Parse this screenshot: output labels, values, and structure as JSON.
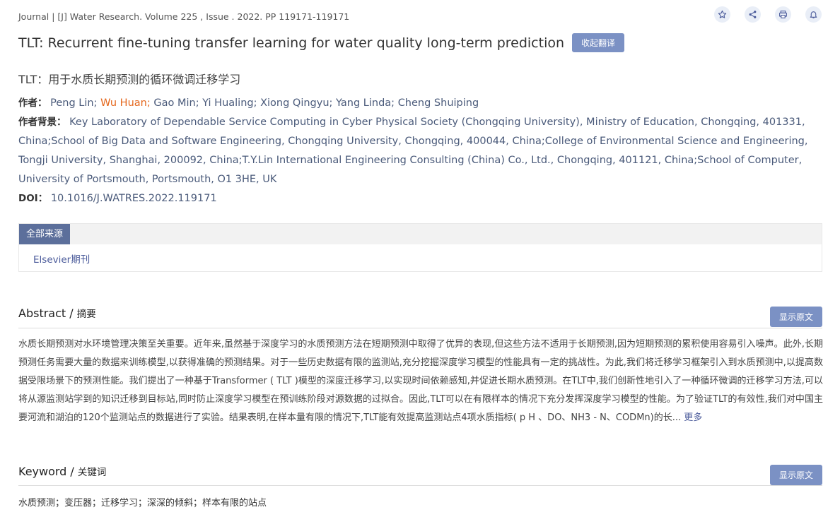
{
  "journal_line": "Journal | [J] Water Research. Volume 225 , Issue . 2022. PP 119171-119171",
  "toolbar": {
    "icons": [
      "star-icon",
      "share-icon",
      "print-icon",
      "bell-icon"
    ]
  },
  "title_en": "TLT: Recurrent fine-tuning transfer learning for water quality long-term prediction",
  "collect_translation_label": "收起翻译",
  "title_cn": "TLT：用于水质长期预测的循环微调迁移学习",
  "authors_label": "作者：",
  "authors": [
    {
      "name": "Peng Lin;",
      "highlight": false
    },
    {
      "name": "Wu Huan;",
      "highlight": true
    },
    {
      "name": "Gao Min;",
      "highlight": false
    },
    {
      "name": "Yi Hualing;",
      "highlight": false
    },
    {
      "name": "Xiong Qingyu;",
      "highlight": false
    },
    {
      "name": "Yang Linda;",
      "highlight": false
    },
    {
      "name": "Cheng Shuiping",
      "highlight": false
    }
  ],
  "affiliation_label": "作者背景：",
  "affiliation": "Key Laboratory of Dependable Service Computing in Cyber Physical Society (Chongqing University), Ministry of Education, Chongqing, 401331, China;School of Big Data and Software Engineering, Chongqing University, Chongqing, 400044, China;College of Environmental Science and Engineering, Tongji University, Shanghai, 200092, China;T.Y.Lin International Engineering Consulting (China) Co., Ltd., Chongqing, 401121, China;School of Computer, University of Portsmouth, Portsmouth, O1 3HE, UK",
  "doi_label": "DOI：",
  "doi": "10.1016/J.WATRES.2022.119171",
  "sources": {
    "tab_label": "全部来源",
    "items": [
      "Elsevier期刊"
    ]
  },
  "abstract_section": {
    "title_en": "Abstract",
    "separator": " / ",
    "title_cn": "摘要",
    "show_original_label": "显示原文",
    "text": "水质长期预测对水环境管理决策至关重要。近年来,虽然基于深度学习的水质预测方法在短期预测中取得了优异的表现,但这些方法不适用于长期预测,因为短期预测的累积使用容易引入噪声。此外,长期预测任务需要大量的数据来训练模型,以获得准确的预测结果。对于一些历史数据有限的监测站,充分挖掘深度学习模型的性能具有一定的挑战性。为此,我们将迁移学习框架引入到水质预测中,以提高数据受限场景下的预测性能。我们提出了一种基于Transformer ( TLT )模型的深度迁移学习,以实现时间依赖感知,并促进长期水质预测。在TLT中,我们创新性地引入了一种循环微调的迁移学习方法,可以将从源监测站学到的知识迁移到目标站,同时防止深度学习模型在预训练阶段对源数据的过拟合。因此,TLT可以在有限样本的情况下充分发挥深度学习模型的性能。为了验证TLT的有效性,我们对中国主要河流和湖泊的120个监测站点的数据进行了实验。结果表明,在样本量有限的情况下,TLT能有效提高监测站点4项水质指标( p H 、DO、NH3 - N、CODMn)的长...",
    "more_label": "更多"
  },
  "keyword_section": {
    "title_en": "Keyword",
    "separator": " / ",
    "title_cn": "关键词",
    "show_original_label": "显示原文",
    "keywords_text": "水质预测；变压器；迁移学习；深深的倾斜；样本有限的站点"
  }
}
